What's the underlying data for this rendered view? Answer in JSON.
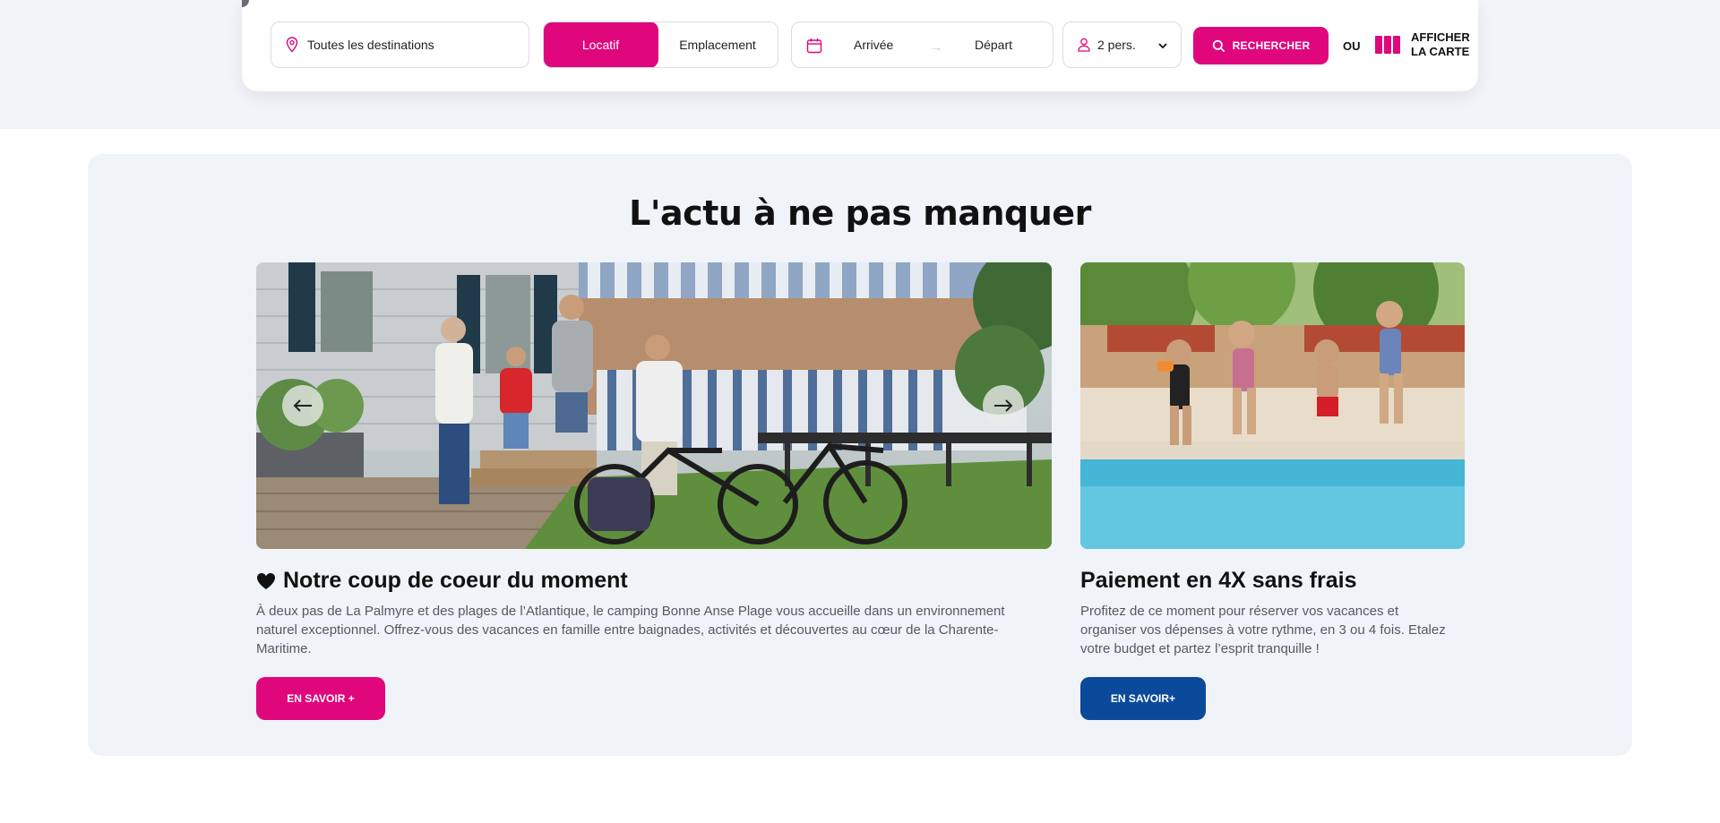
{
  "search": {
    "destination_value": "Toutes les destinations",
    "type_options": [
      {
        "label": "Locatif",
        "active": true
      },
      {
        "label": "Emplacement",
        "active": false
      }
    ],
    "arrival_label": "Arrivée",
    "departure_label": "Départ",
    "date_arrow": "→",
    "persons_value": "2 pers.",
    "search_button": "RECHERCHER",
    "or_label": "OU",
    "map_label_line1": "AFFICHER",
    "map_label_line2": "LA CARTE",
    "icons": {
      "destination": "map-pin-icon",
      "dates": "calendar-icon",
      "persons": "user-icon",
      "persons_dropdown": "chevron-down-icon",
      "search": "search-icon",
      "map": "map-icon"
    }
  },
  "news": {
    "title": "L'actu à ne pas manquer",
    "cards": [
      {
        "title": "Notre coup de coeur du moment",
        "title_icon": "heart-icon",
        "text": "À deux pas de La Palmyre et des plages de l’Atlantique, le camping Bonne Anse Plage vous accueille dans un environnement naturel exceptionnel. Offrez-vous des vacances en famille entre baignades, activités et découvertes au cœur de la Charente-Maritime.",
        "button": "EN SAVOIR +",
        "button_color": "#e0077d",
        "carousel_prev_icon": "arrow-left-icon",
        "carousel_next_icon": "arrow-right-icon"
      },
      {
        "title": "Paiement en 4X sans frais",
        "text": "Profitez de ce moment pour réserver vos vacances et organiser vos dépenses à votre rythme, en 3 ou 4 fois. Etalez votre budget et partez l’esprit tranquille !",
        "button": "EN SAVOIR+",
        "button_color": "#0b4a9b"
      }
    ]
  },
  "colors": {
    "brand_pink": "#e0077d",
    "brand_blue": "#0b4a9b",
    "section_bg": "#f0f3f8"
  }
}
